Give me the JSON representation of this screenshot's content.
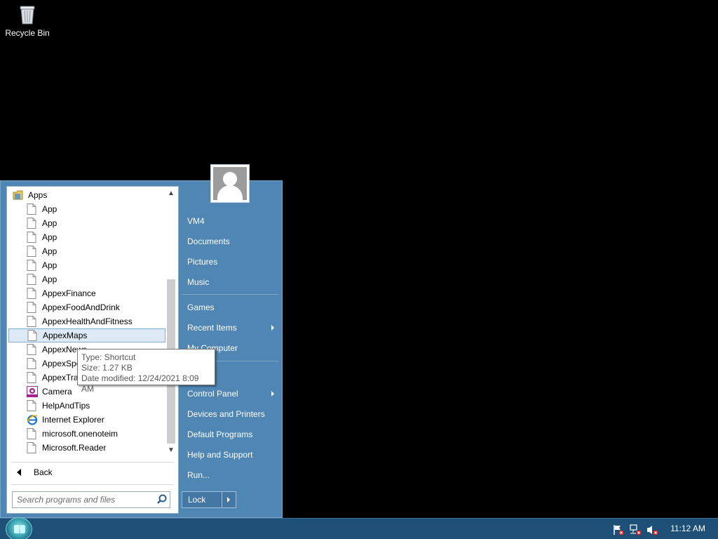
{
  "desktop": {
    "recycle_bin_label": "Recycle Bin"
  },
  "start_menu": {
    "folder_label": "Apps",
    "programs": [
      {
        "label": "App",
        "icon": "file-icon"
      },
      {
        "label": "App",
        "icon": "file-icon"
      },
      {
        "label": "App",
        "icon": "file-icon"
      },
      {
        "label": "App",
        "icon": "file-icon"
      },
      {
        "label": "App",
        "icon": "file-icon"
      },
      {
        "label": "App",
        "icon": "file-icon"
      },
      {
        "label": "AppexFinance",
        "icon": "file-icon"
      },
      {
        "label": "AppexFoodAndDrink",
        "icon": "file-icon"
      },
      {
        "label": "AppexHealthAndFitness",
        "icon": "file-icon"
      },
      {
        "label": "AppexMaps",
        "icon": "file-icon",
        "selected": true
      },
      {
        "label": "AppexNews",
        "icon": "file-icon"
      },
      {
        "label": "AppexSpo",
        "icon": "file-icon"
      },
      {
        "label": "AppexTrav",
        "icon": "file-icon"
      },
      {
        "label": "Camera",
        "icon": "camera-icon"
      },
      {
        "label": "HelpAndTips",
        "icon": "file-icon"
      },
      {
        "label": "Internet Explorer",
        "icon": "internet-explorer-icon"
      },
      {
        "label": "microsoft.onenoteim",
        "icon": "file-icon"
      },
      {
        "label": "Microsoft.Reader",
        "icon": "file-icon"
      }
    ],
    "back_label": "Back",
    "search_placeholder": "Search programs and files",
    "right_items": [
      {
        "label": "VM4",
        "submenu": false
      },
      {
        "label": "Documents",
        "submenu": false
      },
      {
        "label": "Pictures",
        "submenu": false
      },
      {
        "label": "Music",
        "submenu": false
      },
      {
        "label": "Games",
        "submenu": false
      },
      {
        "label": "Recent Items",
        "submenu": true
      },
      {
        "label": "My Computer",
        "submenu": false
      },
      {
        "label": "Control Panel",
        "submenu": true
      },
      {
        "label": "Devices and Printers",
        "submenu": false
      },
      {
        "label": "Default Programs",
        "submenu": false
      },
      {
        "label": "Help and Support",
        "submenu": false
      },
      {
        "label": "Run...",
        "submenu": false
      }
    ],
    "lock_label": "Lock"
  },
  "tooltip": {
    "type": "Type: Shortcut",
    "size": "Size: 1.27 KB",
    "date_modified": "Date modified: 12/24/2021 8:09 AM"
  },
  "taskbar": {
    "clock": "11:12 AM",
    "tray_icons": [
      "action-center-flag-icon",
      "network-icon",
      "volume-muted-icon"
    ]
  },
  "colors": {
    "start_menu_bg": "#4f86b4",
    "taskbar_bg": "#1d4f77",
    "selection_bg": "#dde9f5"
  }
}
